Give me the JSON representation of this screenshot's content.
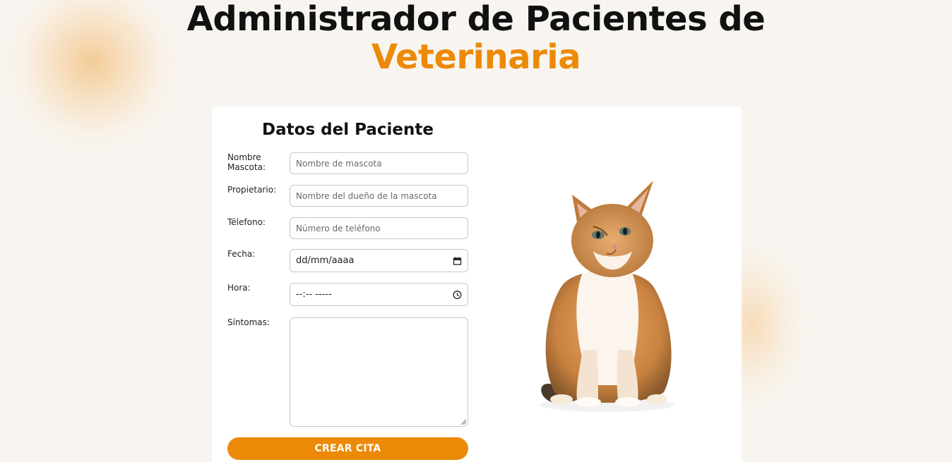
{
  "header": {
    "title_line1": "Administrador de Pacientes de",
    "title_line2": "Veterinaria"
  },
  "form": {
    "title": "Datos del Paciente",
    "fields": {
      "pet_name": {
        "label": "Nombre Mascota:",
        "placeholder": "Nombre de mascota"
      },
      "owner": {
        "label": "Propietario:",
        "placeholder": "Nombre del dueño de la mascota"
      },
      "phone": {
        "label": "Télefono:",
        "placeholder": "Número de teléfono"
      },
      "date": {
        "label": "Fecha:",
        "value": "dd/mm/aaaa",
        "icon": "calendar-icon"
      },
      "time": {
        "label": "Hora:",
        "value": "--:-- -----",
        "icon": "clock-icon"
      },
      "symptoms": {
        "label": "Síntomas:",
        "value": ""
      }
    },
    "submit_label": "CREAR CITA"
  },
  "image": {
    "subject": "cat-photo"
  },
  "colors": {
    "accent": "#ec8a08",
    "background": "#f8f5f0",
    "card": "#ffffff"
  }
}
